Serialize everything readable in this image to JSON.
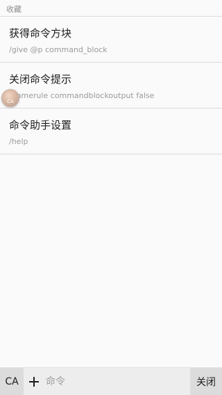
{
  "favorites": {
    "header": "收藏",
    "items": [
      {
        "title": "获得命令方块",
        "command": "/give @p command_block"
      },
      {
        "title": "关闭命令提示",
        "command": "/gamerule commandblockoutput false"
      },
      {
        "title": "命令助手设置",
        "command": "/help"
      }
    ]
  },
  "floating_badge": {
    "label": "CA"
  },
  "bottom_bar": {
    "ca_label": "CA",
    "add_icon": "plus-icon",
    "input_placeholder": "命令",
    "input_value": "",
    "close_label": "关闭"
  }
}
